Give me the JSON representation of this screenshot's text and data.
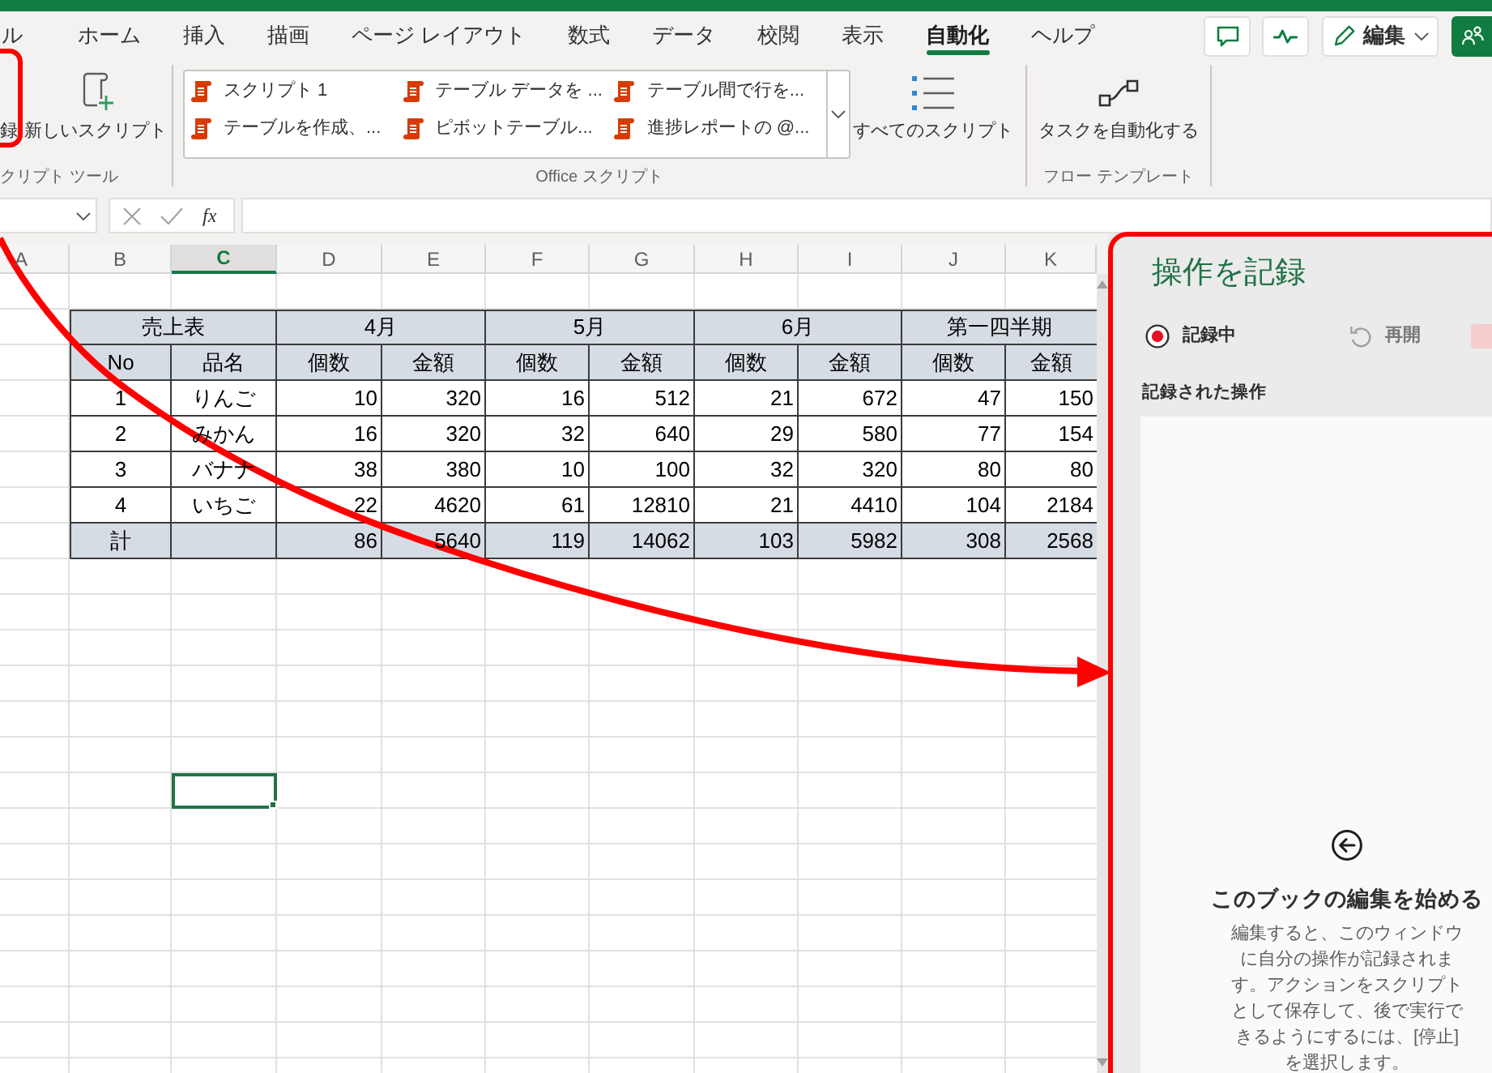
{
  "ribbon_tabs": [
    {
      "label": "ル",
      "selected": false
    },
    {
      "label": "ホーム",
      "selected": false
    },
    {
      "label": "挿入",
      "selected": false
    },
    {
      "label": "描画",
      "selected": false
    },
    {
      "label": "ページ レイアウト",
      "selected": false
    },
    {
      "label": "数式",
      "selected": false
    },
    {
      "label": "データ",
      "selected": false
    },
    {
      "label": "校閲",
      "selected": false
    },
    {
      "label": "表示",
      "selected": false
    },
    {
      "label": "自動化",
      "selected": true
    },
    {
      "label": "ヘルプ",
      "selected": false
    }
  ],
  "header_actions": {
    "edit_label": "編集"
  },
  "ribbon_groups": [
    {
      "label": "クリプト ツール",
      "buttons": [
        {
          "kind": "plain",
          "label": "録"
        },
        {
          "kind": "newscript",
          "label": "新しいスクリプト"
        }
      ]
    },
    {
      "label": "Office スクリプト",
      "gallery_items": [
        "スクリプト 1",
        "テーブル データを ...",
        "テーブル間で行を...",
        "テーブルを作成、...",
        "ピボットテーブル...",
        "進捗レポートの @..."
      ],
      "buttons": [
        {
          "kind": "list",
          "label": "すべてのスクリプト"
        }
      ]
    },
    {
      "label": "フロー テンプレート",
      "buttons": [
        {
          "kind": "flow",
          "label": "タスクを自動化する"
        }
      ]
    }
  ],
  "formula_bar": {
    "function_label": "fx"
  },
  "sheet": {
    "column_headers": [
      {
        "label": "A",
        "selected": false
      },
      {
        "label": "B",
        "selected": false
      },
      {
        "label": "C",
        "selected": true
      },
      {
        "label": "D",
        "selected": false
      },
      {
        "label": "E",
        "selected": false
      },
      {
        "label": "F",
        "selected": false
      },
      {
        "label": "G",
        "selected": false
      },
      {
        "label": "H",
        "selected": false
      },
      {
        "label": "I",
        "selected": false
      },
      {
        "label": "J",
        "selected": false
      },
      {
        "label": "K",
        "selected": false
      }
    ],
    "table": {
      "header_groups": [
        "売上表",
        "4月",
        "5月",
        "6月",
        "第一四半期"
      ],
      "header_columns": [
        "No",
        "品名",
        "個数",
        "金額",
        "個数",
        "金額",
        "個数",
        "金額",
        "個数",
        "金額"
      ],
      "rows": [
        [
          "1",
          "りんご",
          "10",
          "320",
          "16",
          "512",
          "21",
          "672",
          "47",
          "150"
        ],
        [
          "2",
          "みかん",
          "16",
          "320",
          "32",
          "640",
          "29",
          "580",
          "77",
          "154"
        ],
        [
          "3",
          "バナナ",
          "38",
          "380",
          "10",
          "100",
          "32",
          "320",
          "80",
          "80"
        ],
        [
          "4",
          "いちご",
          "22",
          "4620",
          "61",
          "12810",
          "21",
          "4410",
          "104",
          "2184"
        ]
      ],
      "total": {
        "label": "計",
        "values": [
          "86",
          "5640",
          "119",
          "14062",
          "103",
          "5982",
          "308",
          "2568"
        ]
      }
    },
    "blank_rows": [
      {
        "active_cell": false
      },
      {
        "active_cell": false
      },
      {
        "active_cell": false
      },
      {
        "active_cell": false
      },
      {
        "active_cell": false
      },
      {
        "active_cell": false
      },
      {
        "active_cell": true
      },
      {
        "active_cell": false
      },
      {
        "active_cell": false
      },
      {
        "active_cell": false
      },
      {
        "active_cell": false
      },
      {
        "active_cell": false
      },
      {
        "active_cell": false
      },
      {
        "active_cell": false
      },
      {
        "active_cell": false
      }
    ]
  },
  "record_panel": {
    "title": "操作を記録",
    "status": {
      "label": "記録中",
      "recording": true
    },
    "resume_button": {
      "label": "再開",
      "disabled": true
    },
    "stop_button": {
      "disabled": true
    },
    "section_label": "記録された操作",
    "empty_state": {
      "heading": "このブックの編集を始める",
      "text": "編集すると、このウィンドウに自分の操作が記録されます。アクションをスクリプトとして保存して、後で実行できるようにするには、[停止] を選択します。"
    }
  }
}
